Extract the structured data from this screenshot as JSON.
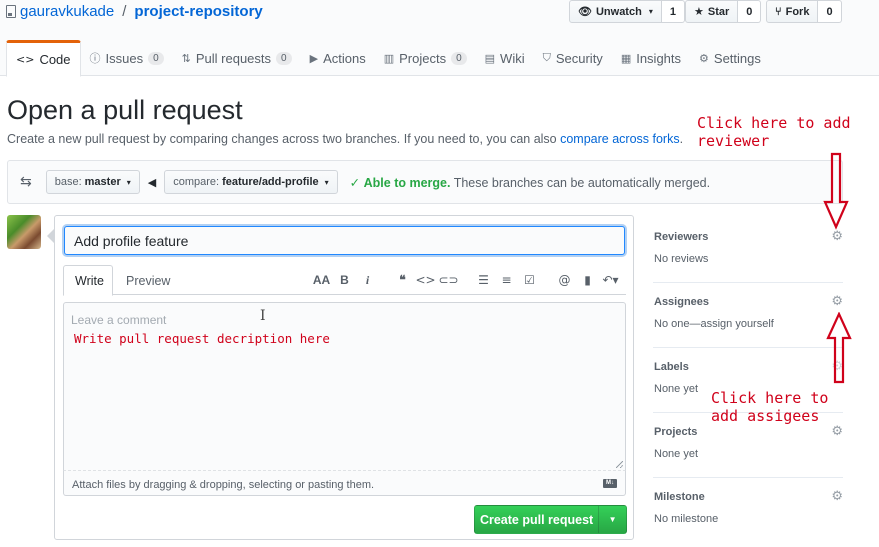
{
  "repo": {
    "owner": "gauravkukade",
    "separator": "/",
    "name": "project-repository"
  },
  "actions": {
    "watch": {
      "label": "Unwatch",
      "count": "1"
    },
    "star": {
      "label": "Star",
      "count": "0"
    },
    "fork": {
      "label": "Fork",
      "count": "0"
    }
  },
  "tabs": [
    {
      "label": "Code",
      "icon": "code-icon"
    },
    {
      "label": "Issues",
      "count": "0",
      "icon": "issue-icon"
    },
    {
      "label": "Pull requests",
      "count": "0",
      "icon": "pull-request-icon"
    },
    {
      "label": "Actions",
      "icon": "play-icon"
    },
    {
      "label": "Projects",
      "count": "0",
      "icon": "project-icon"
    },
    {
      "label": "Wiki",
      "icon": "book-icon"
    },
    {
      "label": "Security",
      "icon": "shield-icon"
    },
    {
      "label": "Insights",
      "icon": "graph-icon"
    },
    {
      "label": "Settings",
      "icon": "gear-icon"
    }
  ],
  "page": {
    "title": "Open a pull request",
    "subtitle": "Create a new pull request by comparing changes across two branches. If you need to, you can also ",
    "subtitle_link": "compare across forks",
    "subtitle_end": "."
  },
  "compare": {
    "base_prefix": "base:",
    "base_branch": "master",
    "compare_prefix": "compare:",
    "compare_branch": "feature/add-profile",
    "merge_ok": "Able to merge.",
    "merge_text": " These branches can be automatically merged."
  },
  "form": {
    "title_value": "Add profile feature",
    "tab_write": "Write",
    "tab_preview": "Preview",
    "comment_placeholder": "Leave a comment",
    "attach_text": "Attach files by dragging & dropping, selecting or pasting them.",
    "submit_label": "Create pull request",
    "toolbar": [
      "header-icon",
      "bold-icon",
      "italic-icon",
      "quote-icon",
      "code-icon",
      "link-icon",
      "unordered-list-icon",
      "ordered-list-icon",
      "task-list-icon",
      "mention-icon",
      "bookmark-icon",
      "reply-icon"
    ]
  },
  "sidebar": [
    {
      "heading": "Reviewers",
      "value": "No reviews"
    },
    {
      "heading": "Assignees",
      "value": "No one—assign yourself"
    },
    {
      "heading": "Labels",
      "value": "None yet"
    },
    {
      "heading": "Projects",
      "value": "None yet"
    },
    {
      "heading": "Milestone",
      "value": "No milestone"
    }
  ],
  "annotations": {
    "reviewer": "Click here to add\nreviewer",
    "assignees": "Click here to\nadd assigees",
    "description": "Write pull request decription here"
  },
  "colors": {
    "accent_tab": "#e36209",
    "link": "#0366d6",
    "success": "#28a745",
    "annotation": "#d0021b"
  }
}
